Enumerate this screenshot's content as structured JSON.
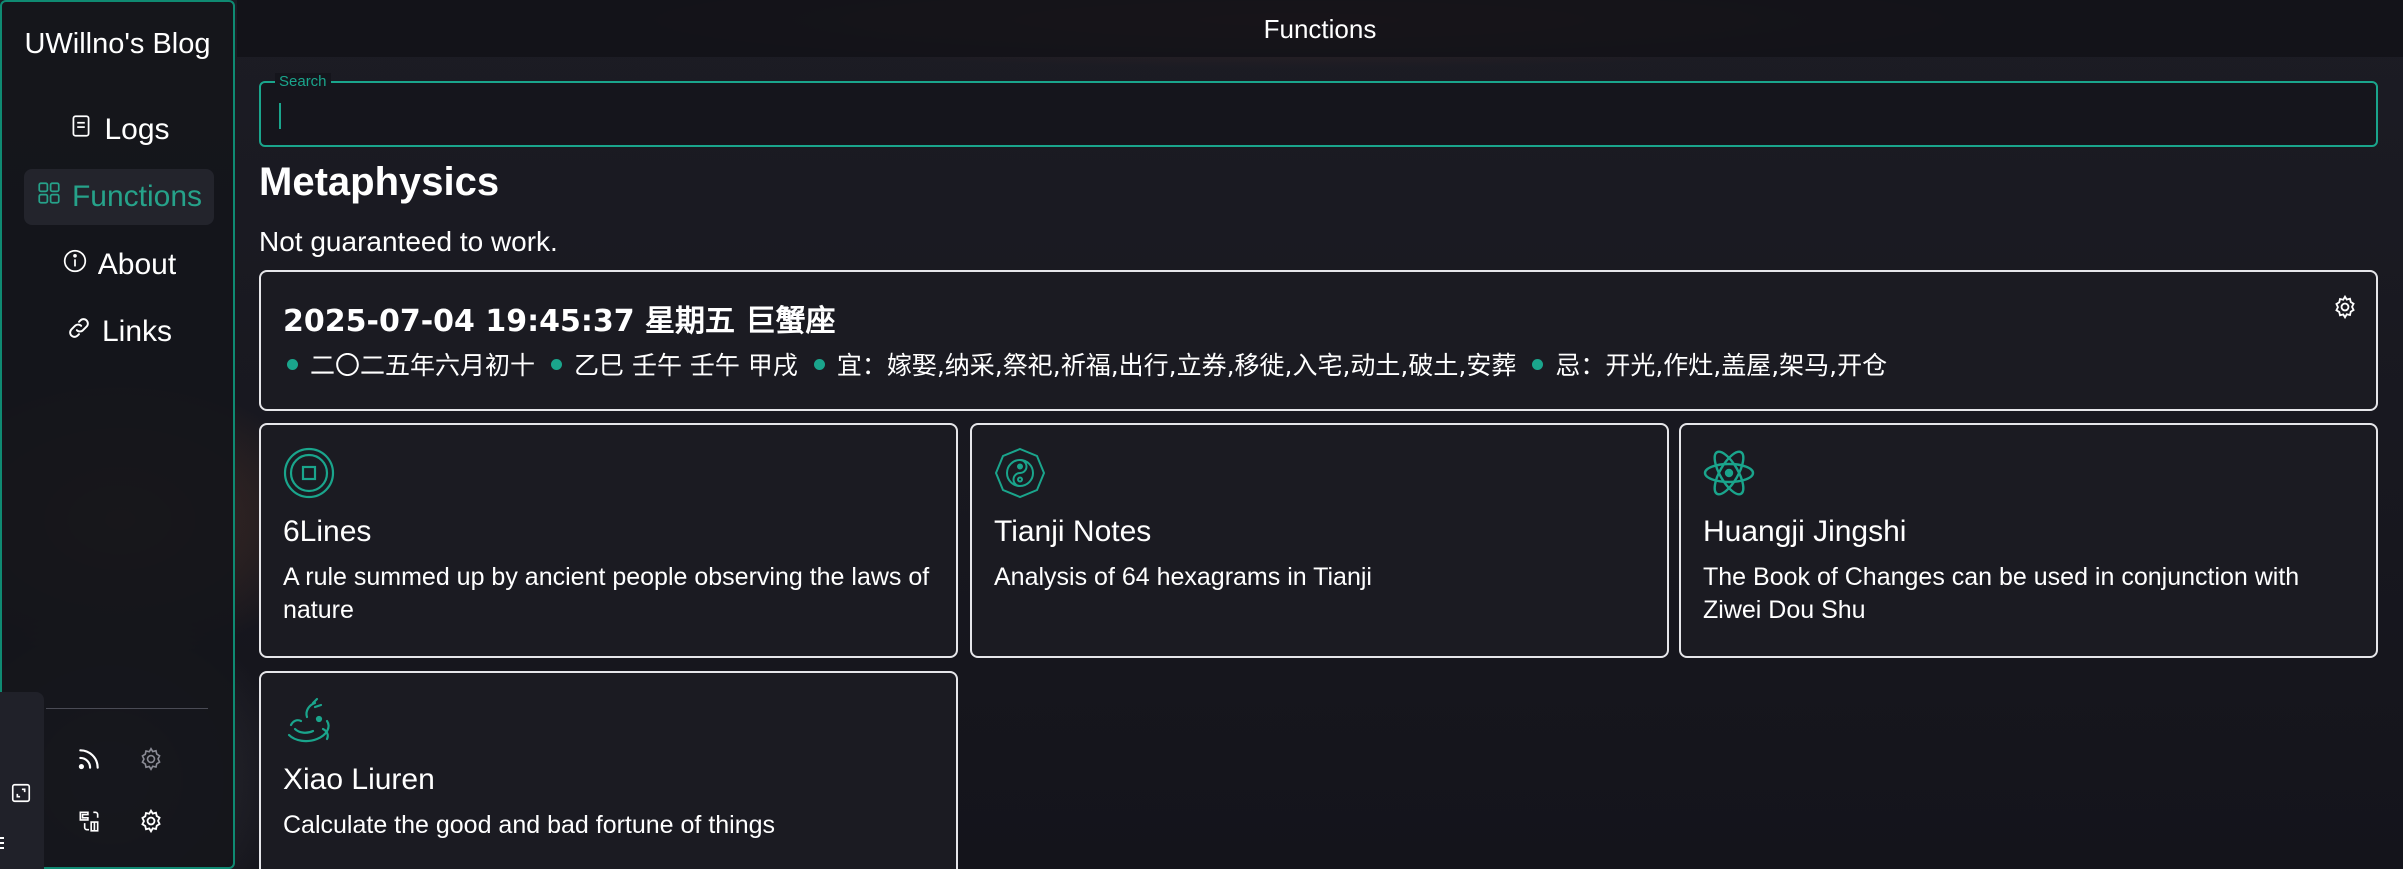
{
  "sidebar": {
    "blog_title": "UWillno's Blog",
    "items": [
      {
        "label": "Logs",
        "icon": "document-icon"
      },
      {
        "label": "Functions",
        "icon": "grid-icon",
        "active": true
      },
      {
        "label": "About",
        "icon": "info-icon"
      },
      {
        "label": "Links",
        "icon": "link-icon"
      }
    ],
    "bottom_icons": [
      "rss-icon",
      "gear-icon",
      "translate-icon",
      "settings-badge-icon"
    ]
  },
  "header": {
    "title": "Functions"
  },
  "search": {
    "label": "Search",
    "value": ""
  },
  "section": {
    "title": "Metaphysics",
    "subtitle": "Not guaranteed to work."
  },
  "calendar": {
    "datetime": "2025-07-04 19:45:37 星期五 巨蟹座",
    "lunar_date": "二〇二五年六月初十",
    "ganzhi": "乙巳 壬午 壬午 甲戌",
    "yi": "宜：嫁娶,纳采,祭祀,祈福,出行,立券,移徙,入宅,动土,破土,安葬",
    "ji": "忌：开光,作灶,盖屋,架马,开仓"
  },
  "functions": [
    {
      "name": "6Lines",
      "desc": "A rule summed up by ancient people observing the laws of nature",
      "icon": "coin-icon"
    },
    {
      "name": "Tianji Notes",
      "desc": "Analysis of 64 hexagrams in Tianji",
      "icon": "bagua-icon"
    },
    {
      "name": "Huangji Jingshi",
      "desc": "The Book of Changes can be used in conjunction with Ziwei Dou Shu",
      "icon": "atom-icon"
    },
    {
      "name": "Xiao Liuren",
      "desc": "Calculate the good and bad fortune of things",
      "icon": "dragon-icon"
    }
  ],
  "colors": {
    "accent": "#1aa58c",
    "card_border": "#e6e6ea",
    "background": "#16161d"
  }
}
